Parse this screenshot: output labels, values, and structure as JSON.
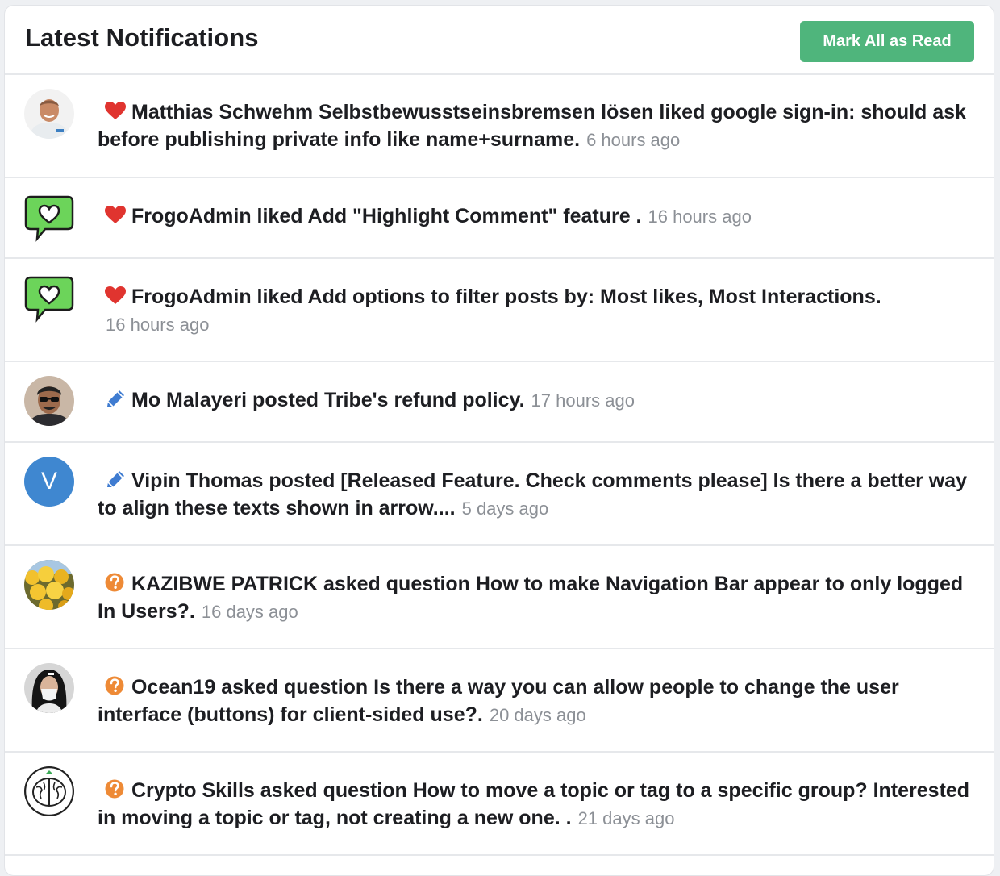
{
  "header": {
    "title": "Latest Notifications",
    "mark_all_label": "Mark All as Read"
  },
  "colors": {
    "accent_button": "#4fb57c",
    "heart": "#e0342f",
    "pencil": "#3f7cd1",
    "question": "#ee8a36",
    "avatar_v": "#3f87d0",
    "chat_bubble": "#6cd45a"
  },
  "notifications": [
    {
      "avatar": "photo-man-smiling",
      "type_icon": "heart-icon",
      "text": "Matthias Schwehm Selbstbewusstseinsbremsen lösen liked google sign-in: should ask before publishing private info like name+surname.",
      "time": "6 hours ago"
    },
    {
      "avatar": "chat-heart-logo",
      "type_icon": "heart-icon",
      "text": "FrogoAdmin liked Add \"Highlight Comment\" feature .",
      "time": "16 hours ago"
    },
    {
      "avatar": "chat-heart-logo",
      "type_icon": "heart-icon",
      "text": "FrogoAdmin liked Add options to filter posts by: Most likes, Most Interactions.",
      "time": "16 hours ago"
    },
    {
      "avatar": "photo-man-glasses",
      "type_icon": "pencil-icon",
      "text": "Mo Malayeri posted Tribe's refund policy.",
      "time": "17 hours ago"
    },
    {
      "avatar": "initial-letter",
      "avatar_letter": "V",
      "type_icon": "pencil-icon",
      "text": "Vipin Thomas posted [Released Feature. Check comments please] Is there a better way to align these texts shown in arrow....",
      "time": "5 days ago"
    },
    {
      "avatar": "photo-yellow-flowers",
      "type_icon": "question-icon",
      "text": "KAZIBWE PATRICK asked question How to make Navigation Bar appear to only logged In Users?.",
      "time": "16 days ago"
    },
    {
      "avatar": "photo-woman-mask",
      "type_icon": "question-icon",
      "text": "Ocean19 asked question Is there a way you can allow people to change the user interface (buttons) for client-sided use?.",
      "time": "20 days ago"
    },
    {
      "avatar": "brain-logo",
      "type_icon": "question-icon",
      "text": "Crypto Skills asked question How to move a topic or tag to a specific group? Interested in moving a topic or tag, not creating a new one. .",
      "time": "21 days ago"
    }
  ]
}
